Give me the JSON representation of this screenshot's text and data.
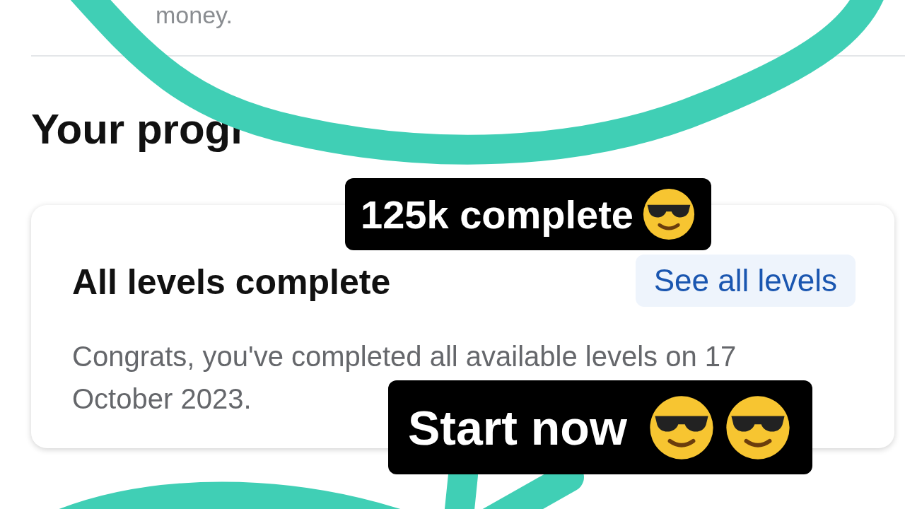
{
  "intro_text": "money.",
  "section_title": "Your progr",
  "progress_card": {
    "title": "All levels complete",
    "link": "See all levels",
    "message": "Congrats, you've completed all available levels on 17 October 2023."
  },
  "stickers": [
    {
      "text": "125k complete",
      "kind": "one_emoji"
    },
    {
      "text": "Start now",
      "kind": "two_emoji"
    }
  ]
}
